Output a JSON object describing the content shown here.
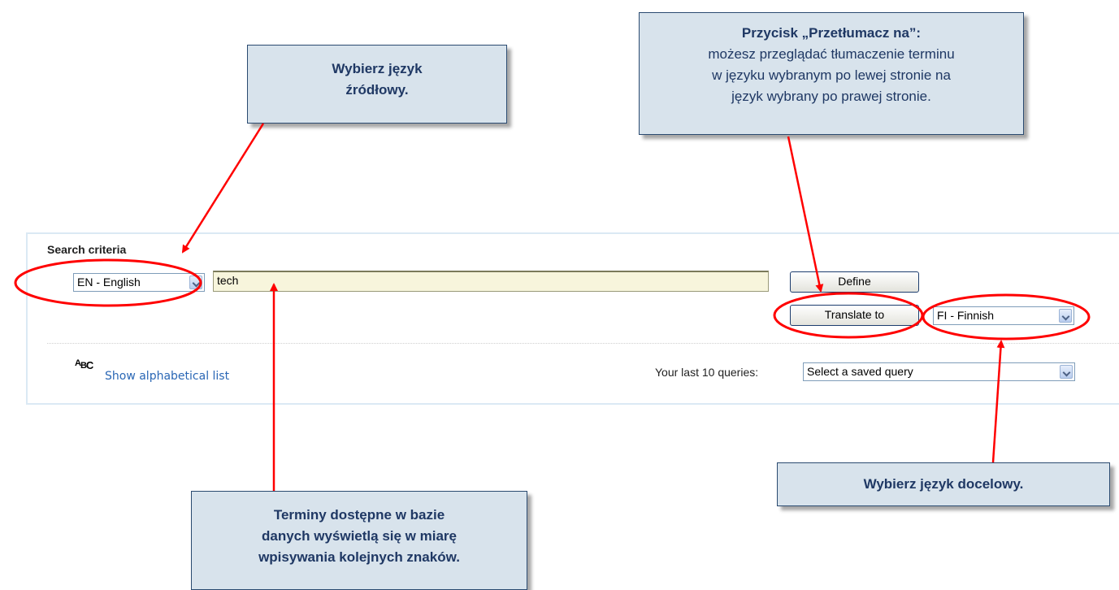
{
  "search": {
    "title": "Search criteria",
    "source_language": "EN - English",
    "term_value": "tech",
    "define_label": "Define",
    "translate_label": "Translate to",
    "target_language": "FI - Finnish",
    "alphabetical_link": "Show alphabetical list",
    "abc_icon_text": {
      "a": "A",
      "b": "B",
      "c": "C"
    },
    "last_queries_label": "Your last 10 queries:",
    "saved_query_placeholder": "Select a saved query"
  },
  "callouts": {
    "source": {
      "line1": "Wybierz język",
      "line2": "źródłowy."
    },
    "translate": {
      "title": "Przycisk „Przetłumacz na”:",
      "line1": "możesz przeglądać tłumaczenie terminu",
      "line2": "w języku wybranym po lewej stronie na",
      "line3": "język wybrany po prawej stronie."
    },
    "target": {
      "text": "Wybierz język docelowy."
    },
    "terms": {
      "line1": "Terminy dostępne w bazie",
      "line2": "danych wyświetlą się w miarę",
      "line3": "wpisywania kolejnych znaków."
    }
  },
  "colors": {
    "annotation": "#ff0000",
    "callout_background": "#d8e3ec",
    "callout_text": "#1f3864",
    "input_background": "#f7f5dc",
    "link": "#2a67b5"
  }
}
